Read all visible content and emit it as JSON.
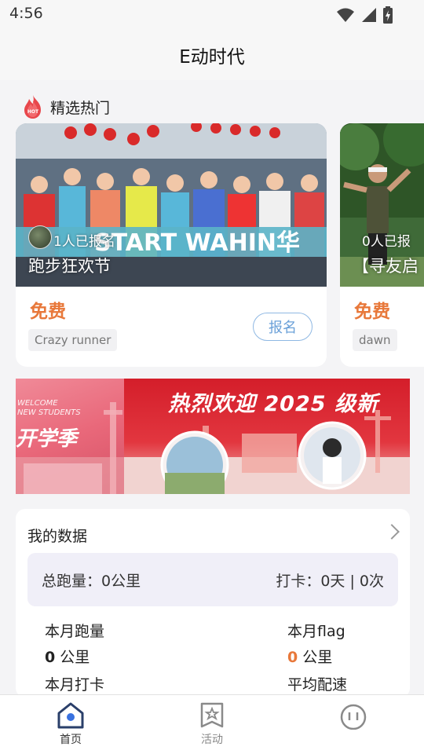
{
  "status_bar": {
    "time": "4:56"
  },
  "header": {
    "title": "E动时代"
  },
  "featured": {
    "section_title": "精选热门",
    "cards": [
      {
        "count_text": "1人已报名",
        "name": "跑步狂欢节",
        "price": "免费",
        "tag": "Crazy runner",
        "button": "报名",
        "banner_text": "START   WAHIN华"
      },
      {
        "count_text": "0人已报",
        "name": "【寻友启",
        "price": "免费",
        "tag": "dawn"
      }
    ]
  },
  "banner": {
    "left_welcome": "WELCOME\nNEW STUDENTS",
    "left_season": "开学季",
    "right_headline": "热烈欢迎 2025 级新"
  },
  "my_data": {
    "title": "我的数据",
    "total_distance": "总跑量：0公里",
    "checkin_summary": "打卡：0天 | 0次",
    "month_distance_label": "本月跑量",
    "month_distance_value": "0",
    "month_distance_unit": " 公里",
    "month_flag_label": "本月flag",
    "month_flag_value": "0",
    "month_flag_unit": " 公里",
    "month_checkin_label": "本月打卡",
    "avg_pace_label": "平均配速"
  },
  "bottom_nav": {
    "items": [
      {
        "label": "首页",
        "icon": "home-icon",
        "active": true
      },
      {
        "label": "活动",
        "icon": "activity-icon",
        "active": false
      },
      {
        "label": "",
        "icon": "profile-icon",
        "active": false
      }
    ]
  },
  "colors": {
    "accent_orange": "#e8783a",
    "join_blue": "#6aa0d8",
    "banner_red": "#d41e2a"
  }
}
